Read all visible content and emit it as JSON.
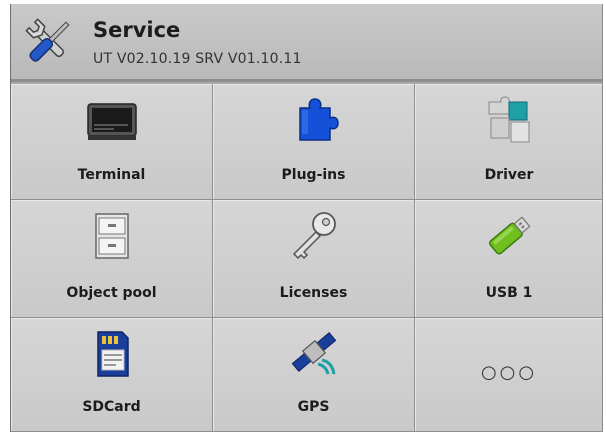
{
  "header": {
    "title": "Service",
    "subtitle": "UT V02.10.19  SRV V01.10.11",
    "icon": "wrench-screwdriver-icon"
  },
  "tiles": [
    {
      "label": "Terminal",
      "icon": "terminal-screen-icon"
    },
    {
      "label": "Plug-ins",
      "icon": "puzzle-piece-icon"
    },
    {
      "label": "Driver",
      "icon": "puzzle-pieces-icon"
    },
    {
      "label": "Object pool",
      "icon": "cabinet-drawers-icon"
    },
    {
      "label": "Licenses",
      "icon": "key-icon"
    },
    {
      "label": "USB 1",
      "icon": "usb-stick-icon"
    },
    {
      "label": "SDCard",
      "icon": "sd-card-icon"
    },
    {
      "label": "GPS",
      "icon": "satellite-icon"
    },
    {
      "label": "",
      "icon": "more-dots-icon",
      "dots": "○○○"
    }
  ],
  "colors": {
    "header_bg": "#c2c2c2",
    "tile_bg": "#d0d0d0",
    "puzzle_blue": "#1450d8",
    "puzzle_teal": "#1fa0a6",
    "usb_green": "#6fbf1e",
    "sd_blue": "#1a3e9c"
  }
}
